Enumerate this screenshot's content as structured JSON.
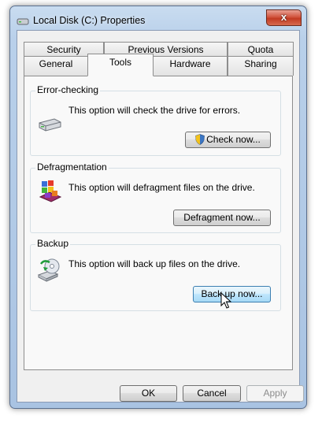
{
  "window": {
    "title": "Local Disk (C:) Properties",
    "close_glyph": "x"
  },
  "tabs": {
    "row_top": [
      {
        "label": "Security",
        "name": "tab-security"
      },
      {
        "label": "Previous Versions",
        "name": "tab-previous-versions"
      },
      {
        "label": "Quota",
        "name": "tab-quota"
      }
    ],
    "row_bottom": [
      {
        "label": "General",
        "name": "tab-general"
      },
      {
        "label": "Tools",
        "name": "tab-tools",
        "active": true
      },
      {
        "label": "Hardware",
        "name": "tab-hardware"
      },
      {
        "label": "Sharing",
        "name": "tab-sharing"
      }
    ]
  },
  "groups": {
    "error_checking": {
      "label": "Error-checking",
      "description": "This option will check the drive for errors.",
      "button": "Check now...",
      "icon": "hard-drive-icon"
    },
    "defragmentation": {
      "label": "Defragmentation",
      "description": "This option will defragment files on the drive.",
      "button": "Defragment now...",
      "icon": "defragment-icon"
    },
    "backup": {
      "label": "Backup",
      "description": "This option will back up files on the drive.",
      "button": "Back up now...",
      "icon": "backup-icon"
    }
  },
  "footer": {
    "ok": "OK",
    "cancel": "Cancel",
    "apply": "Apply"
  },
  "colors": {
    "accent": "#3c7fb1",
    "window_frame": "#b9d0ea",
    "close_button": "#c23a22"
  }
}
